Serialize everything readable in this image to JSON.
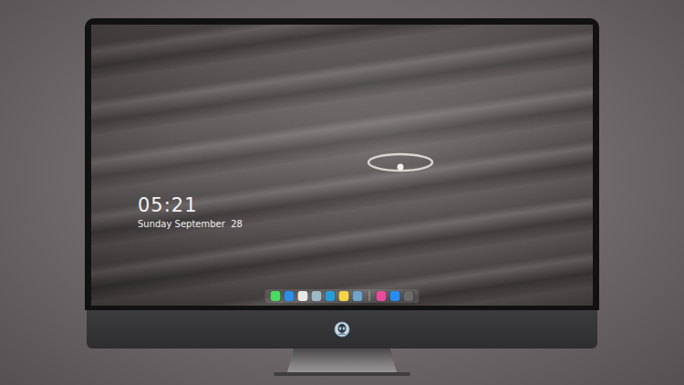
{
  "clock": {
    "time": "05:21",
    "date": "Sunday September  28"
  },
  "dock": {
    "items": [
      {
        "kind": "app",
        "color": "#4cd964"
      },
      {
        "kind": "app",
        "color": "#2d8ee6"
      },
      {
        "kind": "app",
        "color": "#e8e8e8"
      },
      {
        "kind": "app",
        "color": "#9fb8c8"
      },
      {
        "kind": "app",
        "color": "#2a9ad8"
      },
      {
        "kind": "app",
        "color": "#f5d54a"
      },
      {
        "kind": "app",
        "color": "#6fa3c7"
      },
      {
        "kind": "separator"
      },
      {
        "kind": "app",
        "color": "#e84c9c"
      },
      {
        "kind": "app",
        "color": "#2b8cf0"
      },
      {
        "kind": "app",
        "color": "#6a6a6a"
      }
    ]
  }
}
